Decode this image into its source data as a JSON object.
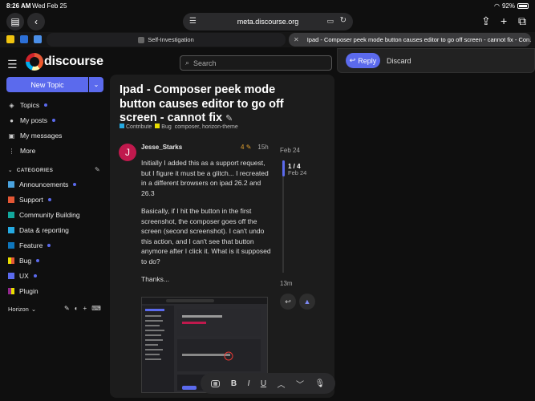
{
  "status_bar": {
    "time": "8:26 AM",
    "date": "Wed Feb 25",
    "battery": "92%"
  },
  "browser": {
    "url": "meta.discourse.org",
    "tabs": [
      {
        "label": "Self-Investigation"
      },
      {
        "label": "Ipad - Composer peek mode button causes editor to go off screen - cannot fix - Con..."
      }
    ]
  },
  "header": {
    "logo_text": "discourse",
    "search_placeholder": "Search"
  },
  "popover": {
    "reply_label": "Reply",
    "discard_label": "Discard"
  },
  "sidebar": {
    "new_topic_label": "New Topic",
    "items": [
      {
        "label": "Topics",
        "icon": "layers-icon",
        "dot": true
      },
      {
        "label": "My posts",
        "icon": "user-icon",
        "dot": true
      },
      {
        "label": "My messages",
        "icon": "inbox-icon",
        "dot": false
      },
      {
        "label": "More",
        "icon": "more-icon",
        "dot": false
      }
    ],
    "categories_heading": "CATEGORIES",
    "categories": [
      {
        "label": "Announcements",
        "color": "#4aa3df",
        "dot": true
      },
      {
        "label": "Support",
        "color": "#e45735",
        "dot": true
      },
      {
        "label": "Community Building",
        "color": "#12a89d",
        "dot": false
      },
      {
        "label": "Data & reporting",
        "color": "#25aae2",
        "dot": false
      },
      {
        "label": "Feature",
        "color": "#0e76bd",
        "dot": true
      },
      {
        "label": "Bug",
        "color": "#e9dd00",
        "dot": true
      },
      {
        "label": "UX",
        "color": "#5b6aed",
        "dot": true
      },
      {
        "label": "Plugin",
        "color": "#92278f",
        "dot": false
      }
    ],
    "theme_label": "Horizon"
  },
  "topic": {
    "title": "Ipad - Composer peek mode button causes editor to go off screen - cannot fix",
    "tags": [
      {
        "label": "Contribute",
        "color": "#25aae2"
      },
      {
        "label": "Bug",
        "color": "#e9dd00"
      }
    ],
    "tag_text": "composer, horizon-theme"
  },
  "post": {
    "avatar_letter": "J",
    "username": "Jesse_Starks",
    "edits": "4",
    "age": "15h",
    "paragraphs": [
      "Initially I added this as a support request, but I figure it must be a glitch... I recreated in a different browsers on ipad 26.2 and 26.3",
      "Basically, if I hit the button in the first screenshot, the composer goes off the screen (second screenshot). I can't undo this action, and I can't see that button anymore after I click it. What is it supposed to do?",
      "Thanks..."
    ]
  },
  "timeline": {
    "start_date": "Feb 24",
    "position": "1 / 4",
    "position_date": "Feb 24",
    "end_label": "13m"
  },
  "keyboard_bar": {
    "items": [
      "B",
      "I",
      "U"
    ]
  }
}
